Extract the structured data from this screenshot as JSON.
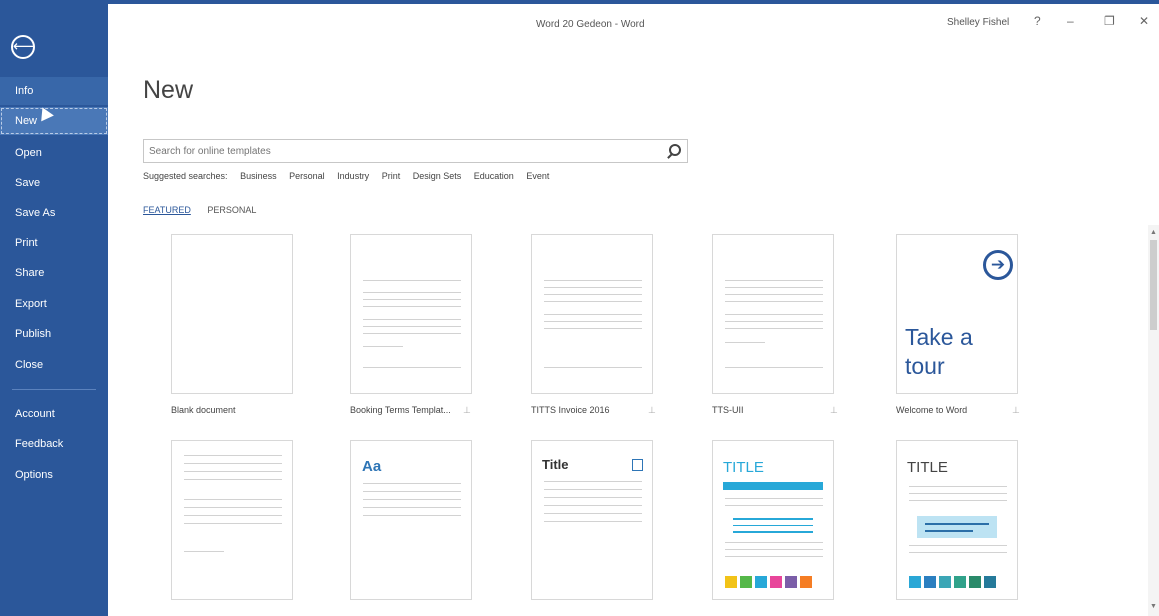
{
  "window": {
    "title": "Word 20 Gedeon - Word",
    "user": "Shelley Fishel",
    "help": "?",
    "minimize": "–",
    "restore": "❐",
    "close": "✕"
  },
  "sidebar": {
    "back": "⟵",
    "items": [
      {
        "label": "Info"
      },
      {
        "label": "New"
      },
      {
        "label": "Open"
      },
      {
        "label": "Save"
      },
      {
        "label": "Save As"
      },
      {
        "label": "Print"
      },
      {
        "label": "Share"
      },
      {
        "label": "Export"
      },
      {
        "label": "Publish"
      },
      {
        "label": "Close"
      },
      {
        "label": "Account"
      },
      {
        "label": "Feedback"
      },
      {
        "label": "Options"
      }
    ]
  },
  "main": {
    "title": "New",
    "search_placeholder": "Search for online templates",
    "suggested_label": "Suggested searches:",
    "suggested": [
      "Business",
      "Personal",
      "Industry",
      "Print",
      "Design Sets",
      "Education",
      "Event"
    ],
    "tabs": [
      "FEATURED",
      "PERSONAL"
    ],
    "templates": [
      {
        "label": "Blank document"
      },
      {
        "label": "Booking Terms Templat..."
      },
      {
        "label": "TITTS Invoice 2016"
      },
      {
        "label": "TTS-UII"
      },
      {
        "label": "Welcome to Word",
        "tour_line1": "Take a",
        "tour_line2": "tour"
      }
    ],
    "row2": {
      "aa": "Aa",
      "title_a": "Title",
      "title_b": "TITLE",
      "title_c": "TITLE"
    }
  },
  "colors": {
    "accent": "#2b579a",
    "sidebar": "#2b579a"
  }
}
